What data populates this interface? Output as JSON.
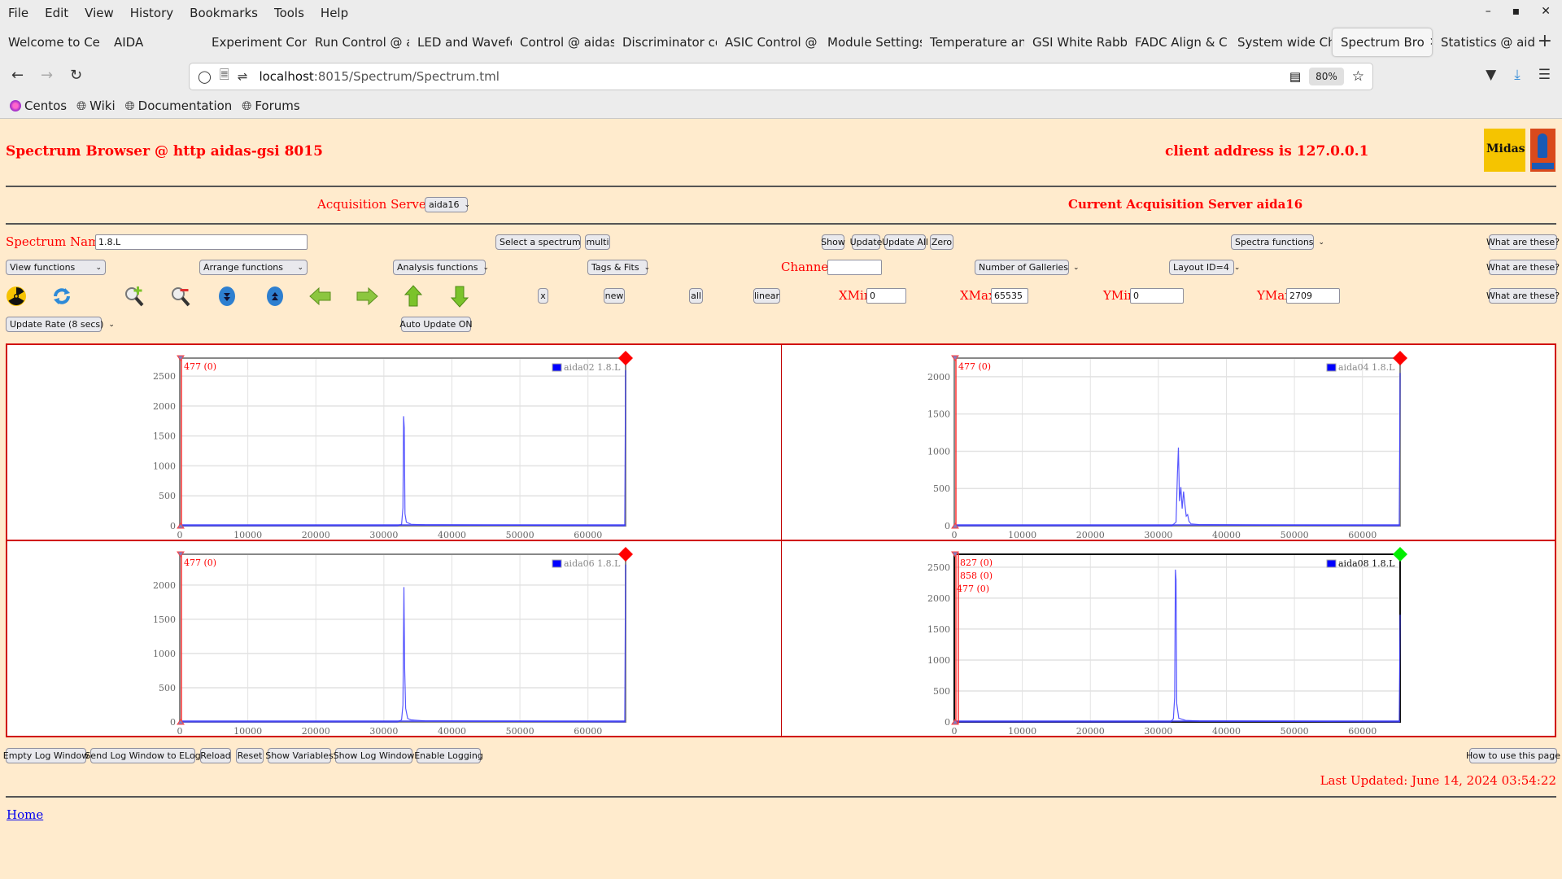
{
  "browser": {
    "menu": [
      "File",
      "Edit",
      "View",
      "History",
      "Bookmarks",
      "Tools",
      "Help"
    ],
    "window_controls": [
      "minimize",
      "maximize",
      "close"
    ],
    "tabs": [
      {
        "label": "Welcome to Ce",
        "active": false
      },
      {
        "label": "AIDA",
        "active": false
      },
      {
        "label": "Experiment Con",
        "active": false
      },
      {
        "label": "Run Control @ a",
        "active": false
      },
      {
        "label": "LED and Wavefo",
        "active": false
      },
      {
        "label": "Control @ aidas",
        "active": false
      },
      {
        "label": "Discriminator co",
        "active": false
      },
      {
        "label": "ASIC Control @",
        "active": false
      },
      {
        "label": "Module Settings",
        "active": false
      },
      {
        "label": "Temperature an",
        "active": false
      },
      {
        "label": "GSI White Rabbi",
        "active": false
      },
      {
        "label": "FADC Align & C",
        "active": false
      },
      {
        "label": "System wide Ch",
        "active": false
      },
      {
        "label": "Spectrum Bro",
        "active": true
      },
      {
        "label": "Statistics @ aida",
        "active": false
      }
    ],
    "url_host": "localhost",
    "url_path": ":8015/Spectrum/Spectrum.tml",
    "zoom": "80%",
    "bookmarks": [
      "Centos",
      "Wiki",
      "Documentation",
      "Forums"
    ]
  },
  "page": {
    "title": "Spectrum Browser @ http aidas-gsi 8015",
    "client_address": "client address is 127.0.0.1",
    "acq_servers_label": "Acquisition Servers",
    "acq_server_selected": "aida16",
    "current_acq_server": "Current Acquisition Server aida16",
    "spectrum_name_label": "Spectrum Name:",
    "spectrum_name_value": "1.8.L",
    "select_spectrum": "Select a spectrum",
    "multi": "multi",
    "show": "Show",
    "update": "Update",
    "update_all": "Update All",
    "zero": "Zero",
    "spectra_functions": "Spectra functions",
    "what_are_these": "What are these?",
    "view_functions": "View functions",
    "arrange_functions": "Arrange functions",
    "analysis_functions": "Analysis functions",
    "tags_fits": "Tags & Fits",
    "channel_label": "Channel:",
    "channel_value": "",
    "number_of_galleries": "Number of Galleries",
    "layout_id": "Layout ID=4",
    "x_btn": "x",
    "new_btn": "new",
    "all_btn": "all",
    "linear_btn": "linear",
    "xmin_label": "XMin",
    "xmin_value": "0",
    "xmax_label": "XMax",
    "xmax_value": "65535",
    "ymin_label": "YMin",
    "ymin_value": "0",
    "ymax_label": "YMax",
    "ymax_value": "2709",
    "update_rate": "Update Rate (8 secs)",
    "auto_update": "Auto Update ON",
    "toolbar_icons": [
      "radiation-icon",
      "refresh-icon",
      "zoom-in-icon",
      "zoom-out-icon",
      "expand-down-icon",
      "expand-up-icon",
      "arrow-left-icon",
      "arrow-right-icon",
      "arrow-up-icon",
      "arrow-down-icon"
    ],
    "bottom_buttons": [
      "Empty Log Window",
      "Send Log Window to ELog",
      "Reload",
      "Reset",
      "Show Variables",
      "Show Log Window",
      "Enable Logging"
    ],
    "how_to": "How to use this page",
    "last_updated": "Last Updated: June 14, 2024 03:54:22",
    "home_link": "Home",
    "colors": {
      "accent_red": "#ff0000",
      "background": "#ffebcd",
      "series_blue": "#0000ff",
      "selected_marker": "#00ff00"
    }
  },
  "chart_data": [
    {
      "type": "line",
      "title": "",
      "legend": "aida02 1.8.L",
      "legend_position": "top-right",
      "xlim": [
        0,
        65535
      ],
      "ylim": [
        0,
        2800
      ],
      "xticks": [
        "0",
        "10000",
        "20000",
        "30000",
        "40000",
        "50000",
        "60000"
      ],
      "yticks": [
        "0",
        "500",
        "1000",
        "1500",
        "2000",
        "2500"
      ],
      "markers": [
        "477 (0)"
      ],
      "status": "red",
      "series": [
        {
          "name": "aida02 1.8.L",
          "x": [
            0,
            32000,
            32600,
            32800,
            32900,
            33000,
            33100,
            33300,
            34000,
            36000,
            45000,
            55000,
            65400,
            65535
          ],
          "y": [
            0,
            0,
            20,
            300,
            1830,
            1640,
            200,
            60,
            25,
            15,
            10,
            5,
            0,
            2600
          ]
        }
      ]
    },
    {
      "type": "line",
      "title": "",
      "legend": "aida04 1.8.L",
      "legend_position": "top-right",
      "xlim": [
        0,
        65535
      ],
      "ylim": [
        0,
        2250
      ],
      "xticks": [
        "0",
        "10000",
        "20000",
        "30000",
        "40000",
        "50000",
        "60000"
      ],
      "yticks": [
        "0",
        "500",
        "1000",
        "1500",
        "2000"
      ],
      "markers": [
        "477 (0)"
      ],
      "status": "red",
      "series": [
        {
          "name": "aida04 1.8.L",
          "x": [
            0,
            32000,
            32600,
            32800,
            32950,
            33100,
            33300,
            33500,
            33700,
            33900,
            34100,
            34300,
            34500,
            34800,
            36000,
            45000,
            55000,
            65400,
            65535
          ],
          "y": [
            0,
            0,
            50,
            700,
            1050,
            330,
            520,
            230,
            460,
            280,
            130,
            150,
            60,
            25,
            15,
            8,
            4,
            0,
            2050
          ]
        }
      ]
    },
    {
      "type": "line",
      "title": "",
      "legend": "aida06 1.8.L",
      "legend_position": "top-right",
      "xlim": [
        0,
        65535
      ],
      "ylim": [
        0,
        2450
      ],
      "xticks": [
        "0",
        "10000",
        "20000",
        "30000",
        "40000",
        "50000",
        "60000"
      ],
      "yticks": [
        "0",
        "500",
        "1000",
        "1500",
        "2000"
      ],
      "markers": [
        "477 (0)"
      ],
      "status": "red",
      "series": [
        {
          "name": "aida06 1.8.L",
          "x": [
            0,
            32000,
            32600,
            32800,
            32950,
            33050,
            33200,
            33500,
            34000,
            36000,
            45000,
            55000,
            65400,
            65535
          ],
          "y": [
            0,
            0,
            30,
            250,
            1970,
            780,
            200,
            50,
            30,
            15,
            10,
            5,
            0,
            2300
          ]
        }
      ]
    },
    {
      "type": "line",
      "title": "",
      "legend": "aida08 1.8.L",
      "legend_position": "top-right",
      "xlim": [
        0,
        65535
      ],
      "ylim": [
        0,
        2709
      ],
      "xticks": [
        "0",
        "10000",
        "20000",
        "30000",
        "40000",
        "50000",
        "60000"
      ],
      "yticks": [
        "0",
        "500",
        "1000",
        "1500",
        "2000",
        "2500"
      ],
      "markers": [
        "827 (0)",
        "858 (0)",
        "477 (0)"
      ],
      "status": "green",
      "series": [
        {
          "name": "aida08 1.8.L",
          "x": [
            0,
            31800,
            32200,
            32400,
            32500,
            32600,
            32700,
            33000,
            34000,
            36000,
            45000,
            55000,
            65400,
            65535
          ],
          "y": [
            0,
            0,
            50,
            400,
            2460,
            2300,
            300,
            60,
            25,
            15,
            10,
            5,
            0,
            1730
          ]
        }
      ]
    }
  ]
}
